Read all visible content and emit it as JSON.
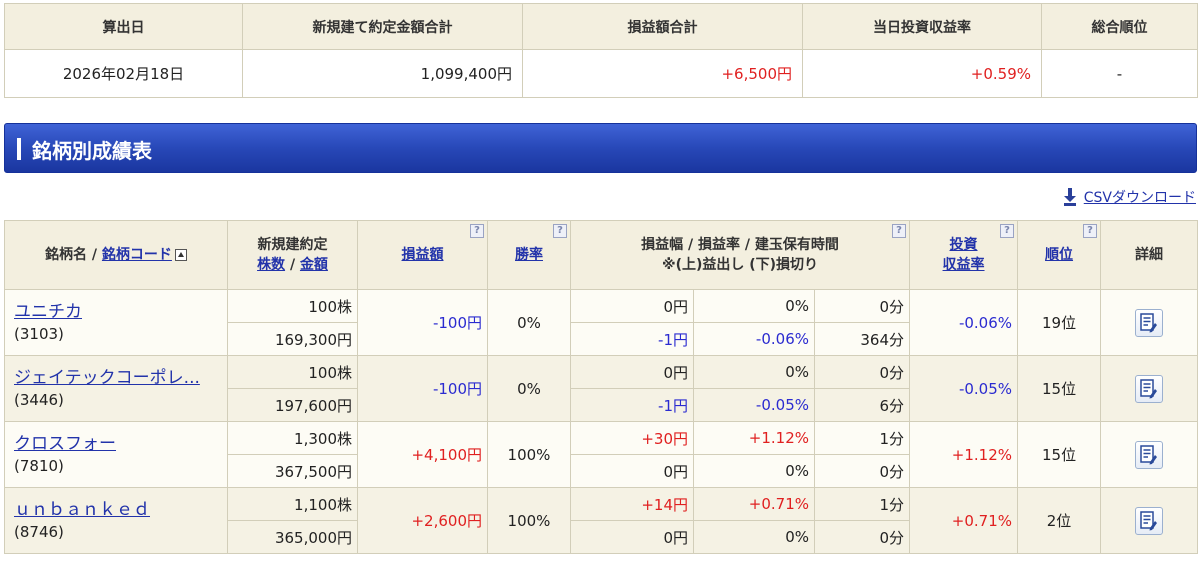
{
  "summary": {
    "headers": [
      "算出日",
      "新規建て約定金額合計",
      "損益額合計",
      "当日投資収益率",
      "総合順位"
    ],
    "date": "2026年02月18日",
    "contract_total": "1,099,400円",
    "pnl_total": "+6,500円",
    "daily_return": "+0.59%",
    "overall_rank": "-"
  },
  "section": {
    "title": "銘柄別成績表"
  },
  "csv": {
    "label": "CSVダウンロード",
    "icon": "download-icon"
  },
  "table": {
    "headers": {
      "name_prefix": "銘柄名 /",
      "name_sort_link": "銘柄コード",
      "contract_line1": "新規建約定",
      "contract_shares_link": "株数",
      "contract_sep": "/",
      "contract_amount_link": "金額",
      "pnl": "損益額",
      "winrate": "勝率",
      "range_line1": "損益幅 / 損益率 / 建玉保有時間",
      "range_line2": "※(上)益出し (下)損切り",
      "return_line1": "投資",
      "return_line2": "収益率",
      "rank": "順位",
      "detail": "詳細",
      "help_mark": "?"
    },
    "rows": [
      {
        "name": "ユニチカ",
        "code": "(3103)",
        "shares": "100株",
        "amount": "169,300円",
        "pnl": "-100円",
        "winrate": "0%",
        "profit_yen": "0円",
        "profit_pct": "0%",
        "profit_time": "0分",
        "loss_yen": "-1円",
        "loss_pct": "-0.06%",
        "loss_time": "364分",
        "return": "-0.06%",
        "rank": "19位"
      },
      {
        "name": "ジェイテックコーポレ...",
        "code": "(3446)",
        "shares": "100株",
        "amount": "197,600円",
        "pnl": "-100円",
        "winrate": "0%",
        "profit_yen": "0円",
        "profit_pct": "0%",
        "profit_time": "0分",
        "loss_yen": "-1円",
        "loss_pct": "-0.05%",
        "loss_time": "6分",
        "return": "-0.05%",
        "rank": "15位"
      },
      {
        "name": "クロスフォー",
        "code": "(7810)",
        "shares": "1,300株",
        "amount": "367,500円",
        "pnl": "+4,100円",
        "winrate": "100%",
        "profit_yen": "+30円",
        "profit_pct": "+1.12%",
        "profit_time": "1分",
        "loss_yen": "0円",
        "loss_pct": "0%",
        "loss_time": "0分",
        "return": "+1.12%",
        "rank": "15位"
      },
      {
        "name": "ｕｎｂａｎｋｅｄ",
        "code": "(8746)",
        "shares": "1,100株",
        "amount": "365,000円",
        "pnl": "+2,600円",
        "winrate": "100%",
        "profit_yen": "+14円",
        "profit_pct": "+0.71%",
        "profit_time": "1分",
        "loss_yen": "0円",
        "loss_pct": "0%",
        "loss_time": "0分",
        "return": "+0.71%",
        "rank": "2位"
      }
    ]
  },
  "colors": {
    "positive": "#e02020",
    "negative": "#2b2bd0",
    "header_bg": "#f3efdf",
    "banner": "#2848b8"
  }
}
